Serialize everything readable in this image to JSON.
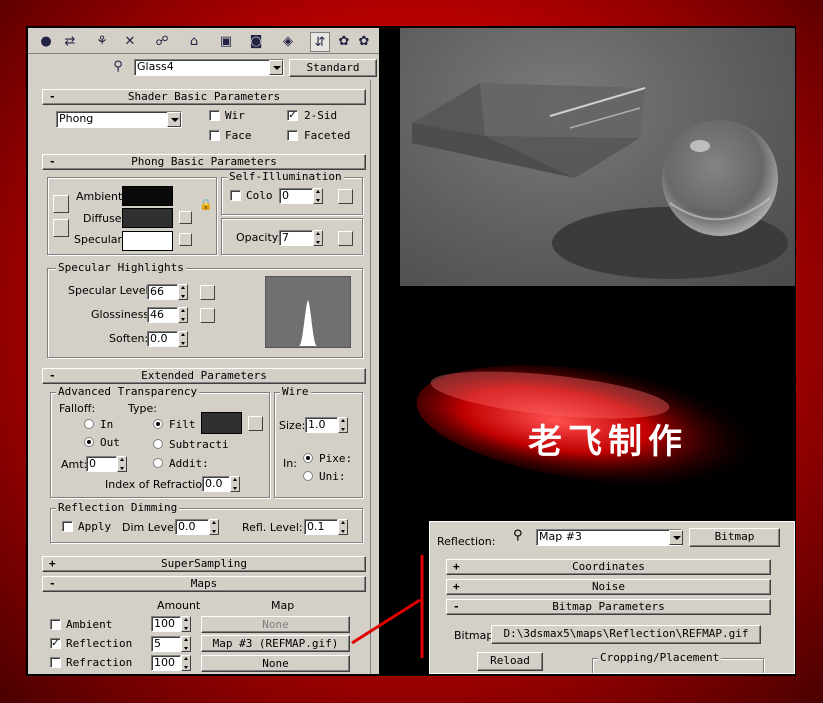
{
  "toolbar": {
    "icons": [
      "get-material-icon",
      "put-to-scene-icon",
      "assign-material-icon",
      "reset-map-icon",
      "make-unique-icon",
      "put-to-library-icon",
      "material-effects-channel-icon",
      "show-map-icon",
      "show-end-result-icon",
      "go-to-parent-icon",
      "go-forward-icon"
    ],
    "material_name": "Glass4",
    "material_type": "Standard"
  },
  "shader_basic": {
    "title": "Shader Basic Parameters",
    "shader": "Phong",
    "wire": "Wir",
    "two_sided": "2-Sid",
    "face": "Face",
    "faceted": "Faceted"
  },
  "phong_basic": {
    "title": "Phong Basic Parameters",
    "ambient": "Ambient:",
    "diffuse": "Diffuse:",
    "specular": "Specular:",
    "self_illum_title": "Self-Illumination",
    "color": "Colo",
    "color_value": "0",
    "opacity": "Opacity:",
    "opacity_value": "7",
    "colors": {
      "ambient": "#0a0a0a",
      "diffuse": "#303030",
      "specular": "#ffffff"
    }
  },
  "specular_highlights": {
    "title": "Specular Highlights",
    "level_label": "Specular Level:",
    "level": "66",
    "gloss_label": "Glossiness:",
    "gloss": "46",
    "soften_label": "Soften:",
    "soften": "0.0"
  },
  "extended": {
    "title": "Extended Parameters",
    "adv_title": "Advanced Transparency",
    "falloff": "Falloff:",
    "type": "Type:",
    "in": "In",
    "out": "Out",
    "filter": "Filt",
    "subtractive": "Subtracti",
    "additive": "Addit:",
    "amt": "Amt:",
    "amt_value": "0",
    "ior_label": "Index of Refraction:",
    "ior": "0.0",
    "wire_title": "Wire",
    "size": "Size:",
    "size_value": "1.0",
    "in_units": "In:",
    "pixels": "Pixe:",
    "units": "Uni:",
    "refl_dim_title": "Reflection Dimming",
    "apply": "Apply",
    "dim_level": "Dim Level:",
    "dim_value": "0.0",
    "refl_level": "Refl. Level:",
    "refl_value": "0.1"
  },
  "supersampling": {
    "title": "SuperSampling"
  },
  "maps": {
    "title": "Maps",
    "amount_header": "Amount",
    "map_header": "Map",
    "rows": [
      {
        "label": "Ambient",
        "amount": "100",
        "map": "None",
        "checked": false
      },
      {
        "label": "Reflection",
        "amount": "5",
        "map": "Map #3 (REFMAP.gif)",
        "checked": true
      },
      {
        "label": "Refraction",
        "amount": "100",
        "map": "None",
        "checked": false
      }
    ]
  },
  "watermark": "老飞制作",
  "reflection_dialog": {
    "label": "Reflection:",
    "map_name": "Map #3",
    "map_type": "Bitmap",
    "coordinates": "Coordinates",
    "noise": "Noise",
    "bitmap_params": "Bitmap Parameters",
    "bitmap_label": "Bitmap:",
    "bitmap_path": "D:\\3dsmax5\\maps\\Reflection\\REFMAP.gif",
    "reload": "Reload",
    "cropping": "Cropping/Placement"
  },
  "colors": {
    "annotation_line": "#e00000"
  }
}
